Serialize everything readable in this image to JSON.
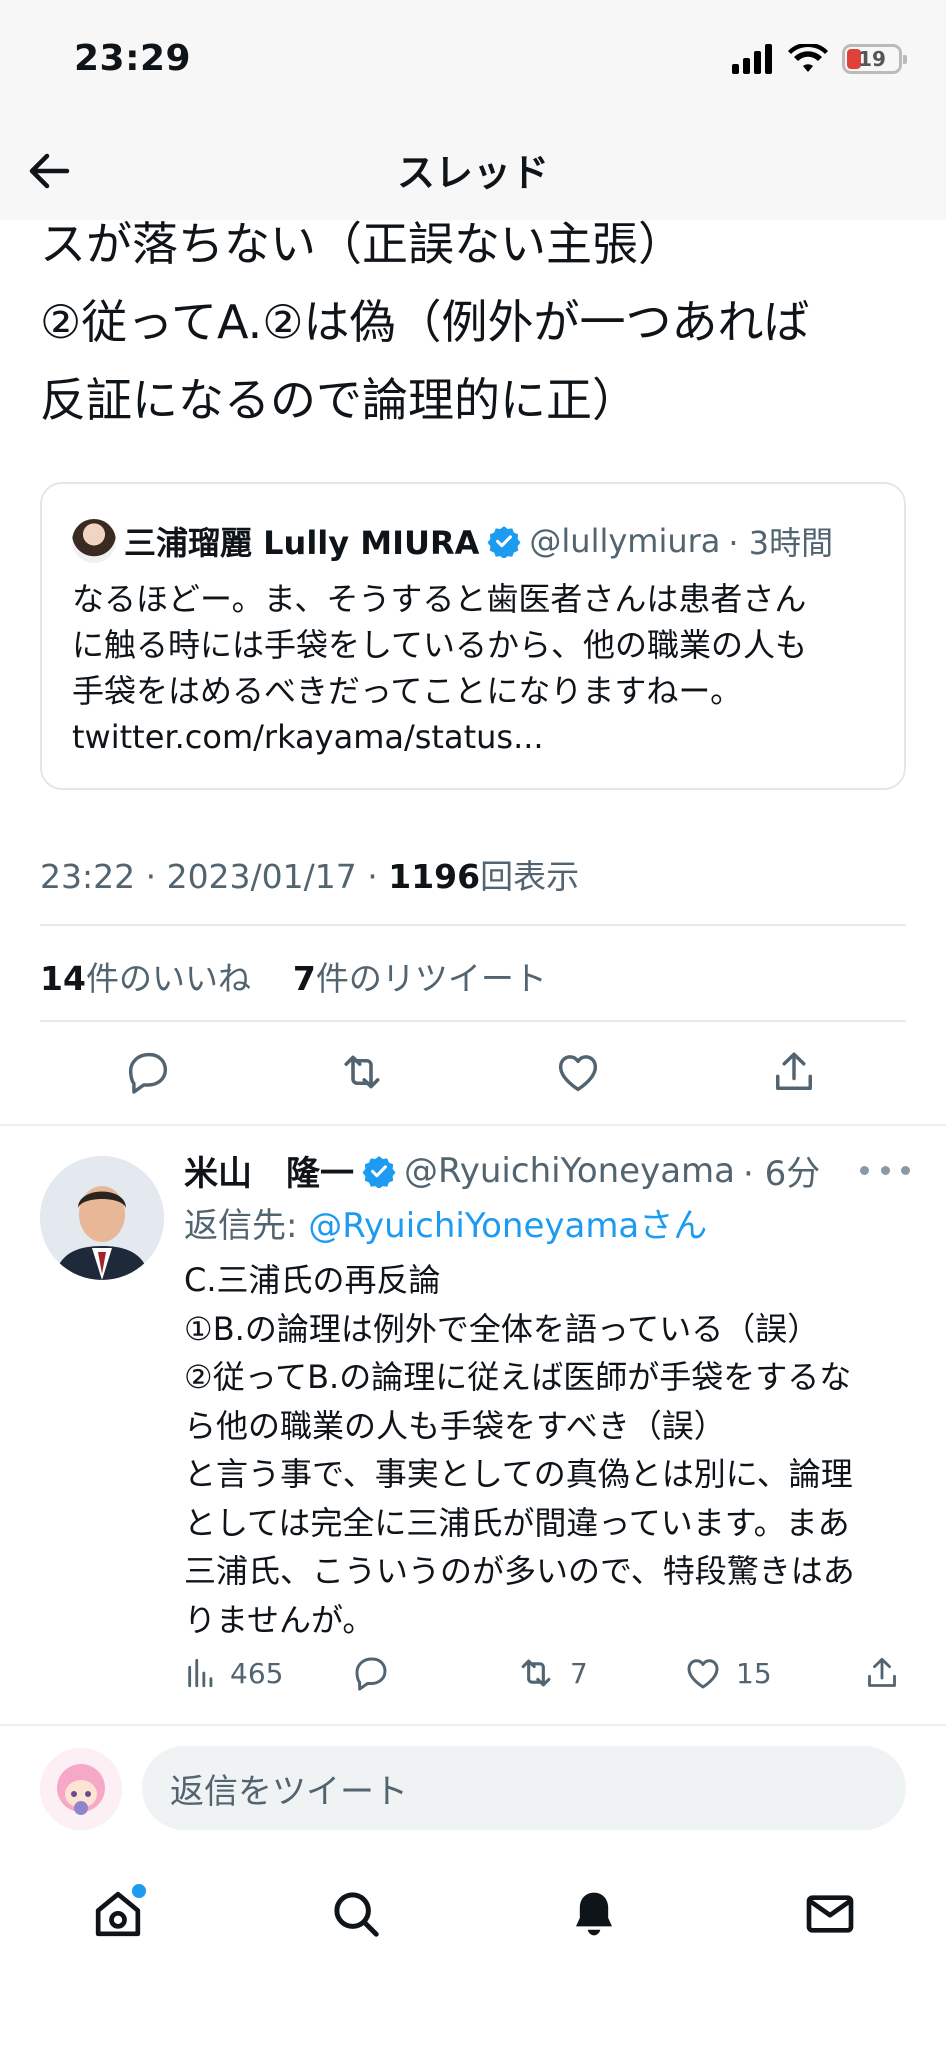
{
  "status_bar": {
    "time": "23:29",
    "battery": "19"
  },
  "header": {
    "title": "スレッド"
  },
  "main_tweet": {
    "text": "スが落ちない（正誤ない主張）\n②従ってA.②は偽（例外が一つあれば\n反証になるので論理的に正）",
    "quote": {
      "name": "三浦瑠麗 Lully MIURA",
      "handle": "@lullymiura",
      "time": "· 3時間",
      "body": "なるほどー。ま、そうすると歯医者さんは患者さん\nに触る時には手袋をしているから、他の職業の人も\n手袋をはめるべきだってことになりますねー。\ntwitter.com/rkayama/status..."
    },
    "meta": {
      "time": "23:22 · 2023/01/17 · ",
      "views": "1196",
      "views_label": "回表示"
    },
    "counts": {
      "likes": "14",
      "likes_label": "件のいいね",
      "retweets": "7",
      "retweets_label": "件のリツイート"
    }
  },
  "reply_tweet": {
    "name": "米山　隆一",
    "handle": "@RyuichiYoneyama",
    "time": "· 6分",
    "reply_to_label": "返信先: ",
    "reply_to_handle": "@RyuichiYoneyama",
    "reply_to_suffix": "さん",
    "body": "C.三浦氏の再反論\n①B.の論理は例外で全体を語っている（誤）\n②従ってB.の論理に従えば医師が手袋をするな\nら他の職業の人も手袋をすべき（誤）\nと言う事で、事実としての真偽とは別に、論理\nとしては完全に三浦氏が間違っています。まあ\n三浦氏、こういうのが多いので、特段驚きはあ\nりませんが。",
    "views": "465",
    "retweets": "7",
    "likes": "15"
  },
  "compose": {
    "placeholder": "返信をツイート"
  },
  "colors": {
    "accent": "#1d9bf0",
    "text": "#0f1419",
    "muted": "#536471"
  }
}
